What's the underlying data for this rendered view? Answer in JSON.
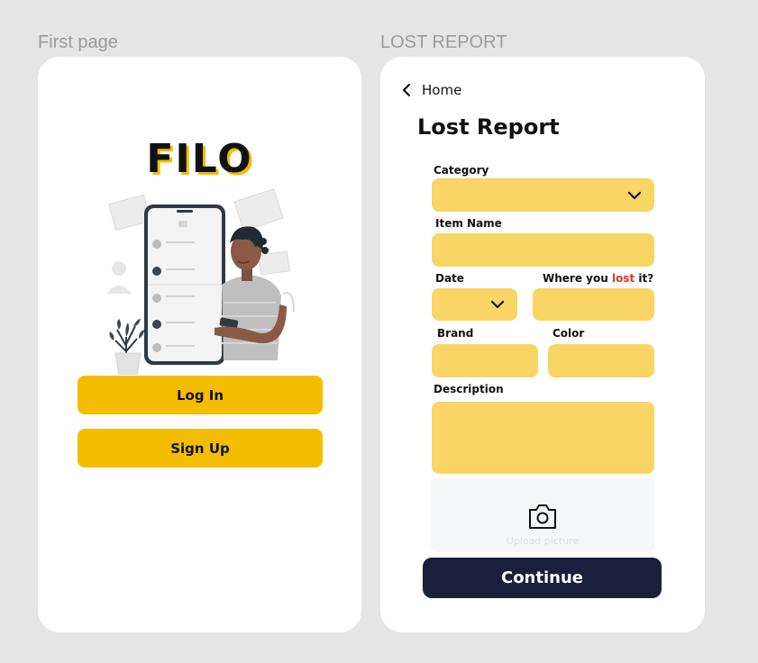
{
  "frames": {
    "first": "First page",
    "lost": "LOST REPORT"
  },
  "first_page": {
    "logo": "FILO",
    "login_label": "Log In",
    "signup_label": "Sign Up"
  },
  "lost_report": {
    "back_label": "Home",
    "title": "Lost Report",
    "category_label": "Category",
    "item_name_label": "Item Name",
    "date_label": "Date",
    "where_label_before": "Where you ",
    "where_label_accent": "lost",
    "where_label_after": " it?",
    "brand_label": "Brand",
    "color_label": "Color",
    "description_label": "Description",
    "upload_label": "Upload picture",
    "continue_label": "Continue"
  },
  "colors": {
    "button_yellow": "#f5bd00",
    "field_yellow": "#f8d564",
    "accent_red": "#e3361b",
    "continue_navy": "#1a1f3b"
  },
  "icons": [
    "back-chevron-icon",
    "dropdown-chevron-icon",
    "camera-icon"
  ]
}
